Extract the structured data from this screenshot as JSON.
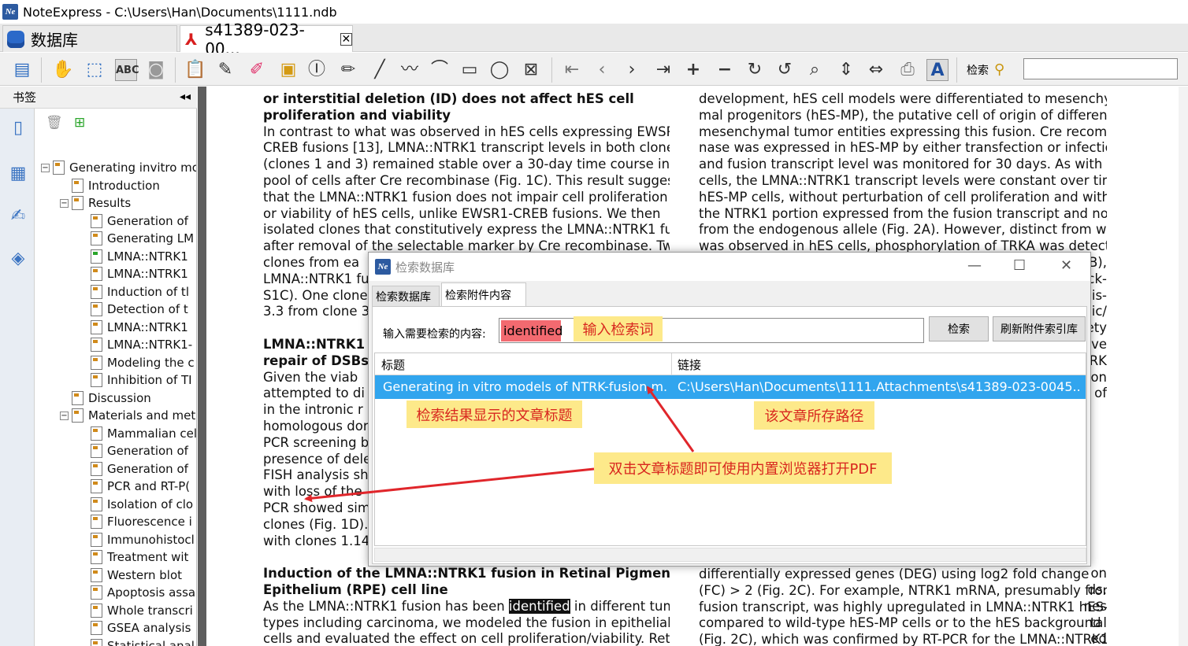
{
  "window": {
    "title": "NoteExpress - C:\\Users\\Han\\Documents\\1111.ndb",
    "app_icon_text": "Ne"
  },
  "tabs": [
    {
      "label": "数据库"
    },
    {
      "label": "s41389-023-00...",
      "close": "✕"
    }
  ],
  "toolbar": {
    "search_label": "检索",
    "search_value": ""
  },
  "left_panel": {
    "header": "书签",
    "collapse": "◂◂",
    "tree": [
      {
        "label": "Generating invitro mo",
        "level": 0
      },
      {
        "label": "Introduction",
        "level": 1
      },
      {
        "label": "Results",
        "level": 1
      },
      {
        "label": "Generation of",
        "level": 2
      },
      {
        "label": "Generating LM",
        "level": 2
      },
      {
        "label": "LMNA::NTRK1",
        "level": 2
      },
      {
        "label": "LMNA::NTRK1",
        "level": 2
      },
      {
        "label": "Induction of tl",
        "level": 2
      },
      {
        "label": "Detection of t",
        "level": 2
      },
      {
        "label": "LMNA::NTRK1",
        "level": 2
      },
      {
        "label": "LMNA::NTRK1-",
        "level": 2
      },
      {
        "label": "Modeling the c",
        "level": 2
      },
      {
        "label": "Inhibition of TI",
        "level": 2
      },
      {
        "label": "Discussion",
        "level": 1
      },
      {
        "label": "Materials and metl",
        "level": 1
      },
      {
        "label": "Mammalian cell",
        "level": 2
      },
      {
        "label": "Generation of",
        "level": 2
      },
      {
        "label": "Generation of",
        "level": 2
      },
      {
        "label": "PCR and RT-P(",
        "level": 2
      },
      {
        "label": "Isolation of clo",
        "level": 2
      },
      {
        "label": "Fluorescence i",
        "level": 2
      },
      {
        "label": "Immunohistocl",
        "level": 2
      },
      {
        "label": "Treatment wit",
        "level": 2
      },
      {
        "label": "Western blot",
        "level": 2
      },
      {
        "label": "Apoptosis assa",
        "level": 2
      },
      {
        "label": "Whole transcri",
        "level": 2
      },
      {
        "label": "GSEA analysis",
        "level": 2
      },
      {
        "label": "Statistical anal",
        "level": 2
      },
      {
        "label": "References",
        "level": 1
      }
    ]
  },
  "document": {
    "left_col": [
      "or interstitial deletion (ID) does not affect hES cell",
      "proliferation and viability",
      "In contrast to what was observed in hES cells expressing EWSR1-",
      "CREB fusions [13], LMNA::NTRK1 transcript levels in both clones",
      "(clones 1 and 3) remained stable over a 30-day time course in a",
      "pool of cells after Cre recombinase (Fig. 1C). This result suggests",
      "that the LMNA::NTRK1 fusion does not impair cell proliferation and/",
      "or viability of hES cells, unlike EWSR1-CREB fusions. We then",
      "isolated clones that constitutively express the LMNA::NTRK1 fusion",
      "after removal of the selectable marker by Cre recombinase. Two",
      "clones from ea",
      "LMNA::NTRK1 fus",
      "S1C). One clone",
      "3.3 from clone 3",
      "",
      "LMNA::NTRK1 fu",
      "repair of DSBs",
      "Given the viab",
      "attempted to di",
      "in the intronic r",
      "homologous dor",
      "PCR screening by",
      "presence of delet",
      "FISH analysis sho",
      "with loss of the",
      "PCR showed sim",
      "clones (Fig. 1D).",
      "with clones 1.14",
      "",
      "Induction of the LMNA::NTRK1 fusion in Retinal Pigment",
      "Epithelium (RPE) cell line",
      "As the LMNA::NTRK1 fusion has been identified in different tumor",
      "types including carcinoma, we modeled the fusion in epithelial",
      "cells and evaluated the effect on cell proliferation/viability. Retinal"
    ],
    "right_col": [
      "development, hES cell models were differentiated to mesenchy-",
      "mal progenitors (hES-MP), the putative cell of origin of different",
      "mesenchymal tumor entities expressing this fusion. Cre recombi-",
      "nase was expressed in hES-MP by either transfection or infection,",
      "and fusion transcript level was monitored for 30 days. As with hES",
      "cells, the LMNA::NTRK1 transcript levels were constant over time in",
      "hES-MP cells, without perturbation of cell proliferation and with",
      "the NTRK1 portion expressed from the fusion transcript and not",
      "from the endogenous allele (Fig. 2A). However, distinct from what",
      "was observed in hES cells, phosphorylation of TRKA was detected"
    ],
    "right_col_fragments": [
      "B),",
      "ck-",
      "is-",
      "ic/",
      "ety",
      "ve",
      "RK",
      "on",
      "of",
      "",
      "",
      "",
      "",
      "",
      "",
      "",
      "",
      "",
      "",
      "on",
      "ds.",
      "nes",
      "tal",
      "ed"
    ],
    "right_col_bottom": [
      "differentially expressed genes (DEG) using log2 fold change",
      "(FC) > 2 (Fig. 2C). For example, NTRK1 mRNA, presumably from the",
      "fusion transcript, was highly upregulated in LMNA::NTRK1 hES-MP",
      "compared to wild-type hES-MP cells or to the hES background",
      "(Fig. 2C), which was confirmed by RT-PCR for the LMNA::NTRK1"
    ],
    "highlight_word": "identified"
  },
  "dialog": {
    "title": "检索数据库",
    "tabs": [
      "检索数据库",
      "检索附件内容"
    ],
    "input_label": "输入需要检索的内容:",
    "query": "identified",
    "search_button": "检索",
    "refresh_button": "刷新附件索引库",
    "columns": [
      "标题",
      "链接"
    ],
    "rows": [
      {
        "title": "Generating in vitro models of NTRK-fusion m...",
        "link": "C:\\Users\\Han\\Documents\\1111.Attachments\\s41389-023-0045..."
      }
    ],
    "window_buttons": {
      "minimize": "—",
      "maximize": "☐",
      "close": "✕"
    }
  },
  "annotations": {
    "query_note": "输入检索词",
    "title_note": "检索结果显示的文章标题",
    "path_note": "该文章所存路径",
    "open_note": "双击文章标题即可使用内置浏览器打开PDF"
  },
  "colors": {
    "selection": "#31a5ee",
    "note_bg": "#fde98a",
    "note_text": "#d8261e",
    "arrow": "#e0262b",
    "query_highlight": "#f26a70"
  }
}
